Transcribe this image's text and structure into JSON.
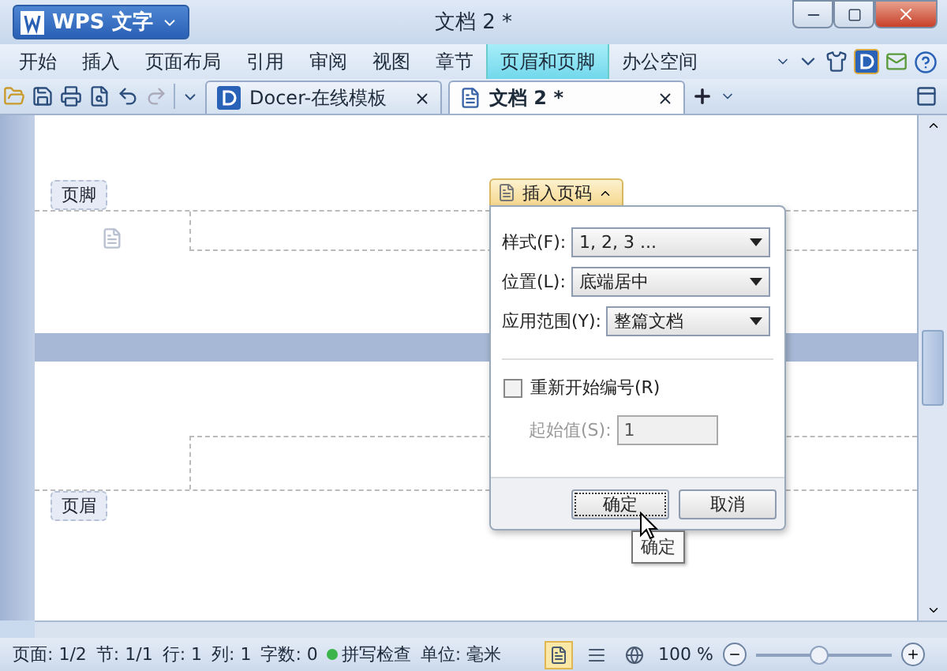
{
  "app_menu": {
    "label": "WPS 文字"
  },
  "window": {
    "title": "文档 2 *"
  },
  "menu": [
    {
      "label": "开始",
      "selected": false
    },
    {
      "label": "插入",
      "selected": false
    },
    {
      "label": "页面布局",
      "selected": false
    },
    {
      "label": "引用",
      "selected": false
    },
    {
      "label": "审阅",
      "selected": false
    },
    {
      "label": "视图",
      "selected": false
    },
    {
      "label": "章节",
      "selected": false
    },
    {
      "label": "页眉和页脚",
      "selected": true
    },
    {
      "label": "办公空间",
      "selected": false
    }
  ],
  "doc_tabs": [
    {
      "label": "Docer-在线模板",
      "selected": false,
      "kind": "docer"
    },
    {
      "label": "文档 2 *",
      "selected": true,
      "kind": "document"
    }
  ],
  "page": {
    "footer_label": "页脚",
    "header_label": "页眉"
  },
  "popup": {
    "title": "插入页码",
    "fields": [
      {
        "label": "样式(F):",
        "value": "1, 2, 3 ..."
      },
      {
        "label": "位置(L):",
        "value": "底端居中"
      },
      {
        "label": "应用范围(Y):",
        "value": "整篇文档"
      }
    ],
    "restart": {
      "label": "重新开始编号(R)",
      "checked": false
    },
    "start": {
      "label": "起始值(S):",
      "value": "1",
      "disabled": true
    },
    "buttons": [
      {
        "label": "确定",
        "focused": true
      },
      {
        "label": "取消",
        "focused": false
      }
    ]
  },
  "tooltip": "确定",
  "status_bar": {
    "items": [
      "页面: 1/2",
      "节: 1/1",
      "行: 1",
      "列: 1",
      "字数: 0"
    ],
    "spell": "拼写检查",
    "unit": "单位: 毫米",
    "zoom": {
      "reading": "100 %",
      "level": 0.45
    }
  }
}
